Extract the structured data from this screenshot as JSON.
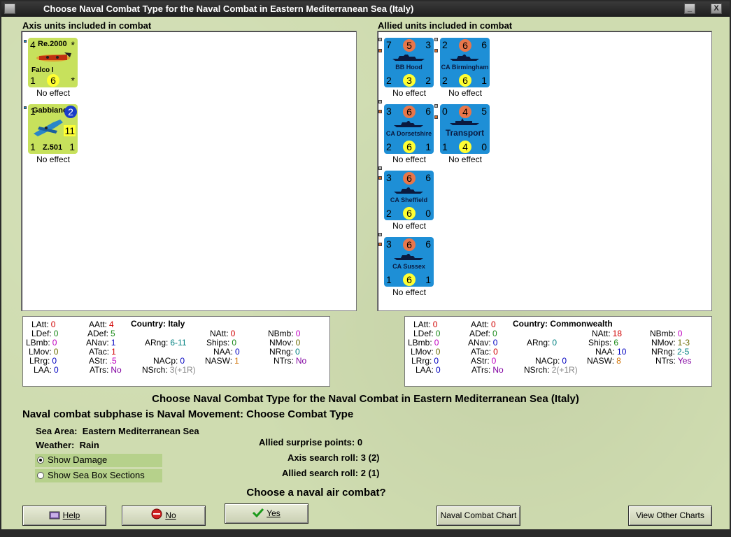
{
  "window": {
    "title": "Choose Naval Combat Type for the Naval Combat in Eastern Mediterranean Sea (Italy)",
    "minimize": "_",
    "close": "X"
  },
  "axis": {
    "header": "Axis units included in combat",
    "units": [
      {
        "name": "Falco I",
        "type": "Re.2000",
        "tl": "4",
        "tr": "*",
        "bl": "1",
        "bm": "6",
        "br": "*",
        "effect": "No effect"
      },
      {
        "name": "Z.501",
        "type": "Gabbiano",
        "tl": "1",
        "tr": "2",
        "mid": "11",
        "bl": "1",
        "br": "1",
        "effect": "No effect"
      }
    ]
  },
  "allied": {
    "header": "Allied units included in combat",
    "units": [
      {
        "name": "BB Hood",
        "tl": "7",
        "tm": "5",
        "tr": "3",
        "bl": "2",
        "bm": "3",
        "br": "2",
        "effect": "No effect"
      },
      {
        "name": "CA Birmingham",
        "tl": "2",
        "tm": "6",
        "tr": "6",
        "bl": "2",
        "bm": "6",
        "br": "1",
        "effect": "No effect"
      },
      {
        "name": "CA Dorsetshire",
        "tl": "3",
        "tm": "6",
        "tr": "6",
        "bl": "2",
        "bm": "6",
        "br": "1",
        "effect": "No effect"
      },
      {
        "name": "Transport",
        "tl": "0",
        "tm": "4",
        "tr": "5",
        "bl": "1",
        "bm": "4",
        "br": "0",
        "effect": "No effect"
      },
      {
        "name": "CA Sheffield",
        "tl": "3",
        "tm": "6",
        "tr": "6",
        "bl": "2",
        "bm": "6",
        "br": "0",
        "effect": "No effect"
      },
      {
        "name": "CA Sussex",
        "tl": "3",
        "tm": "6",
        "tr": "6",
        "bl": "1",
        "bm": "6",
        "br": "1",
        "effect": "No effect"
      }
    ]
  },
  "axis_stats": {
    "country_label": "Country:",
    "country": "Italy",
    "LAtt": "0",
    "LDef": "0",
    "LBmb": "0",
    "LMov": "0",
    "LRrg": "0",
    "LAA": "0",
    "AAtt": "4",
    "ADef": "5",
    "ANav": "1",
    "ATac": "1",
    "AStr": ".5",
    "ATrs": "No",
    "ARng": "6-11",
    "NAtt": "0",
    "Ships": "0",
    "NAA": "0",
    "NASW": "1",
    "NACp": "0",
    "NSrch": "3(+1R)",
    "NBmb": "0",
    "NMov": "0",
    "NRng": "0",
    "NTrs": "No"
  },
  "allied_stats": {
    "country_label": "Country:",
    "country": "Commonwealth",
    "LAtt": "0",
    "LDef": "0",
    "LBmb": "0",
    "LMov": "0",
    "LRrg": "0",
    "LAA": "0",
    "AAtt": "0",
    "ADef": "0",
    "ANav": "0",
    "ATac": "0",
    "AStr": "0",
    "ATrs": "No",
    "ARng": "0",
    "NAtt": "18",
    "Ships": "6",
    "NAA": "10",
    "NASW": "8",
    "NACp": "0",
    "NSrch": "2(+1R)",
    "NBmb": "0",
    "NMov": "1-3",
    "NRng": "2-5",
    "NTrs": "Yes"
  },
  "main": {
    "title": "Choose Naval Combat Type for the Naval Combat in Eastern Mediterranean Sea (Italy)",
    "subphase": "Naval combat subphase is Naval Movement: Choose Combat Type",
    "sea_area_label": "Sea Area:",
    "sea_area": "Eastern Mediterranean Sea",
    "weather_label": "Weather:",
    "weather": "Rain",
    "show_damage": "Show Damage",
    "show_sea_box": "Show Sea Box Sections",
    "surprise_label": "Allied surprise points:",
    "surprise": "0",
    "axis_search_label": "Axis search roll:",
    "axis_search": "3 (2)",
    "allied_search_label": "Allied search roll:",
    "allied_search": "2 (1)",
    "question": "Choose a naval air combat?"
  },
  "buttons": {
    "help": "Help",
    "no": "No",
    "yes": "Yes",
    "naval_chart": "Naval Combat Chart",
    "other_charts": "View Other Charts"
  },
  "colors": {
    "background": "#cfdcb0",
    "axis_counter": "#c7e15c",
    "allied_counter": "#1e8fd6"
  }
}
